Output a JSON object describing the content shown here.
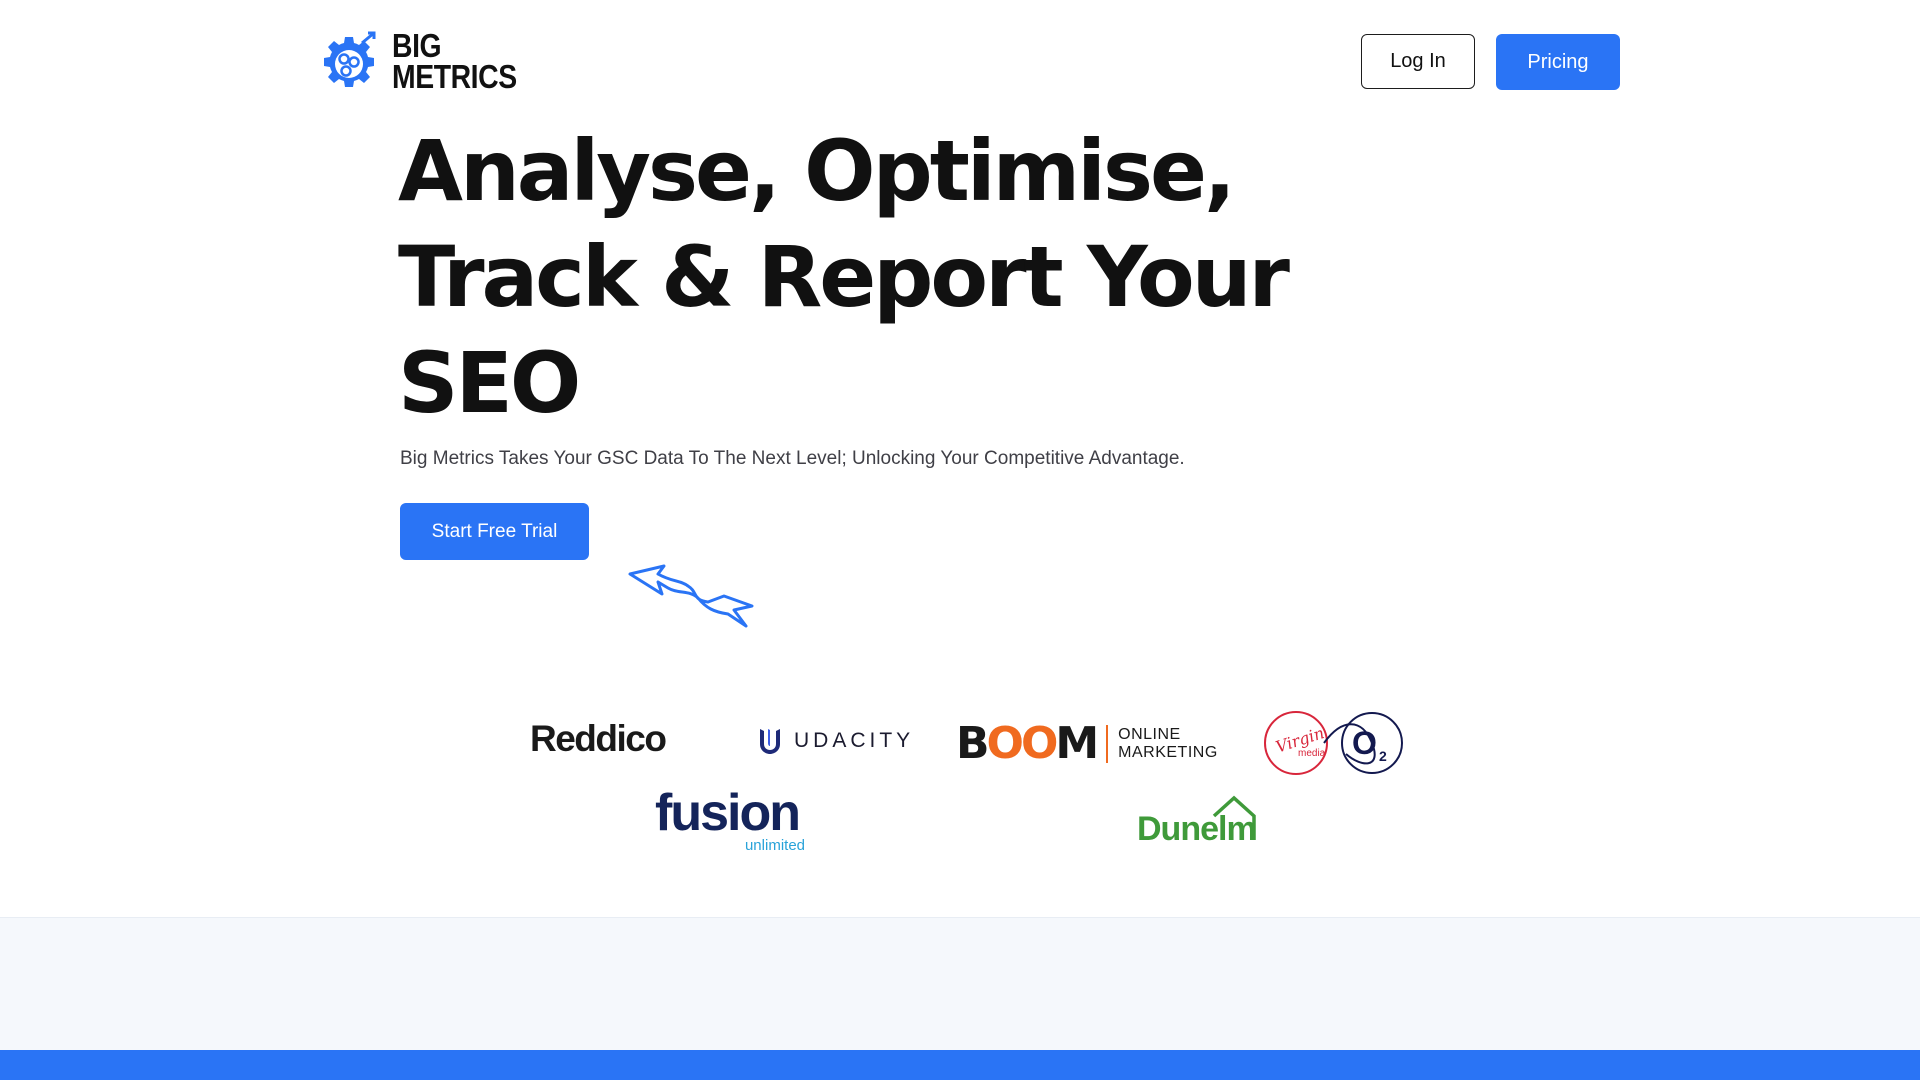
{
  "header": {
    "logo_line1": "BIG",
    "logo_line2": "METRICS",
    "login_label": "Log In",
    "pricing_label": "Pricing"
  },
  "hero": {
    "title_line1": "Analyse, Optimise,",
    "title_line2": "Track & Report Your",
    "title_line3": "SEO",
    "subtitle": "Big Metrics Takes Your GSC Data To The Next Level; Unlocking Your Competitive Advantage.",
    "cta_label": "Start Free Trial"
  },
  "clients": {
    "reddico": "Reddico",
    "udacity": "UDACITY",
    "boom_b": "B",
    "boom_oo": "OO",
    "boom_m": "M",
    "boom_tag1": "ONLINE",
    "boom_tag2": "MARKETING",
    "virgin": "Virgin",
    "virgin_media": "media",
    "o2": "O",
    "o2_sub": "2",
    "fusion": "fusion",
    "fusion_sub": "unlimited",
    "dunelm": "Dunelm"
  },
  "colors": {
    "accent": "#2a74f5",
    "text": "#111111",
    "light_band": "#f5f8fc"
  }
}
